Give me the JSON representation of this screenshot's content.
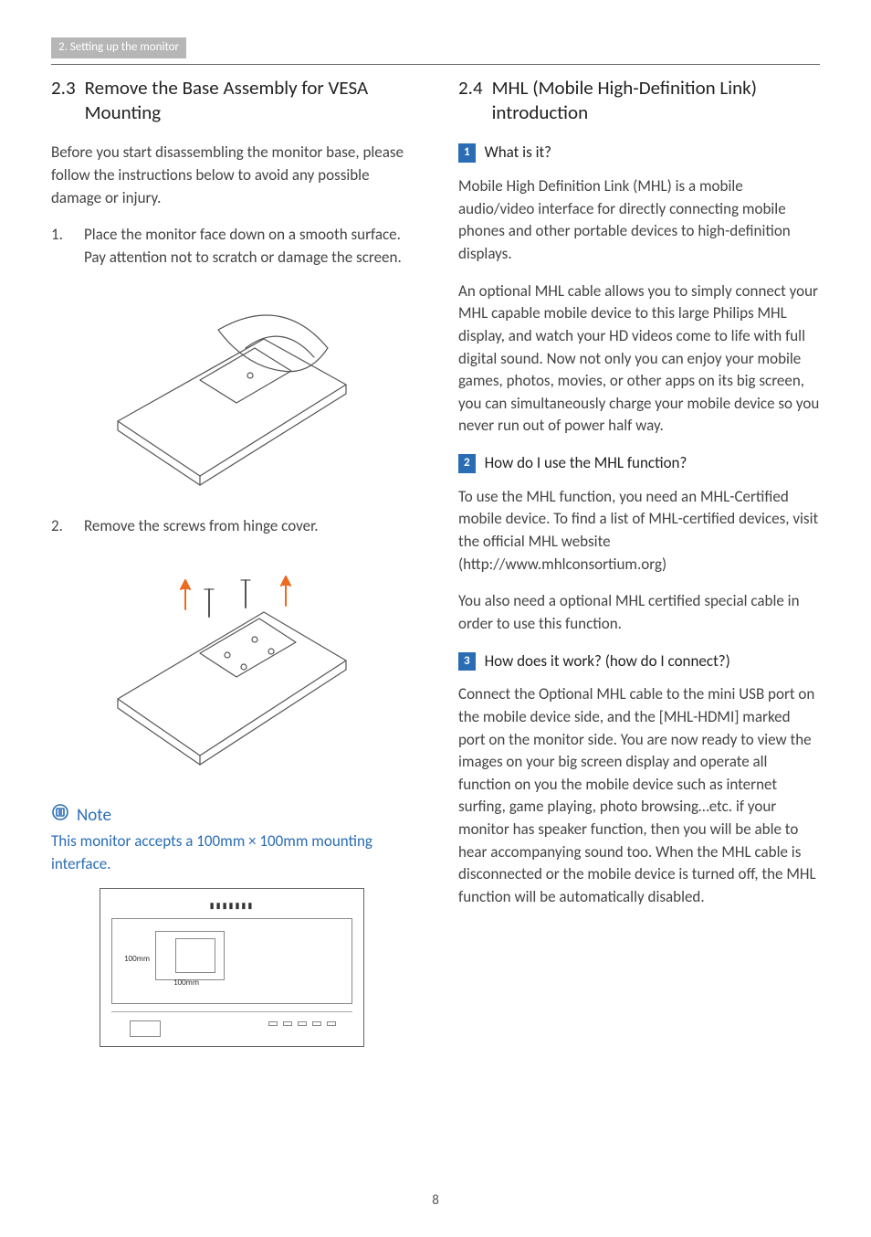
{
  "header_tab": "2. Setting up the monitor",
  "left": {
    "section_num": "2.3",
    "section_title": "Remove the Base Assembly for VESA Mounting",
    "intro": "Before you start disassembling the monitor base, please follow the instructions below to avoid any possible damage or injury.",
    "steps": [
      "Place the monitor face down on a smooth surface. Pay attention not to scratch or damage the screen.",
      "Remove the screws from hinge cover."
    ],
    "note_label": "Note",
    "note_text": "This monitor accepts a 100mm × 100mm mounting interface.",
    "vesa_dims": {
      "w": "100mm",
      "h": "100mm"
    }
  },
  "right": {
    "section_num": "2.4",
    "section_title": "MHL (Mobile High-Definition Link) introduction",
    "q1_badge": "1",
    "q1_title": "What is it?",
    "q1_p1": "Mobile High Definition Link (MHL) is a mobile audio/video interface for directly connecting mobile phones and other portable devices to high-definition displays.",
    "q1_p2": "An optional MHL cable allows you to simply connect your MHL capable mobile device to this large Philips MHL display, and watch your HD videos come to life with full digital sound. Now not only you can enjoy your mobile games, photos, movies, or other apps on its big screen, you can simultaneously charge your mobile device so you never run out of power half way.",
    "q2_badge": "2",
    "q2_title": "How do I use the MHL function?",
    "q2_p1": "To use the MHL function, you need an MHL-Certified mobile device. To find a list of MHL-certified devices, visit the official MHL website (http://www.mhlconsortium.org)",
    "q2_p2": "You also need a optional MHL certified special cable in order to use this function.",
    "q3_badge": "3",
    "q3_title": "How does it work? (how do I connect?)",
    "q3_p1": "Connect the Optional MHL cable to the mini USB port on the mobile device side, and the [MHL-HDMI] marked port on the monitor side. You are now ready to view the images on your big screen display and operate all function on you the mobile device such as internet surfing, game playing, photo browsing…etc. if your monitor has speaker function, then you will be able to hear accompanying sound too. When the MHL cable is disconnected or the mobile device is turned off, the MHL function will be automatically disabled."
  },
  "page_number": "8"
}
